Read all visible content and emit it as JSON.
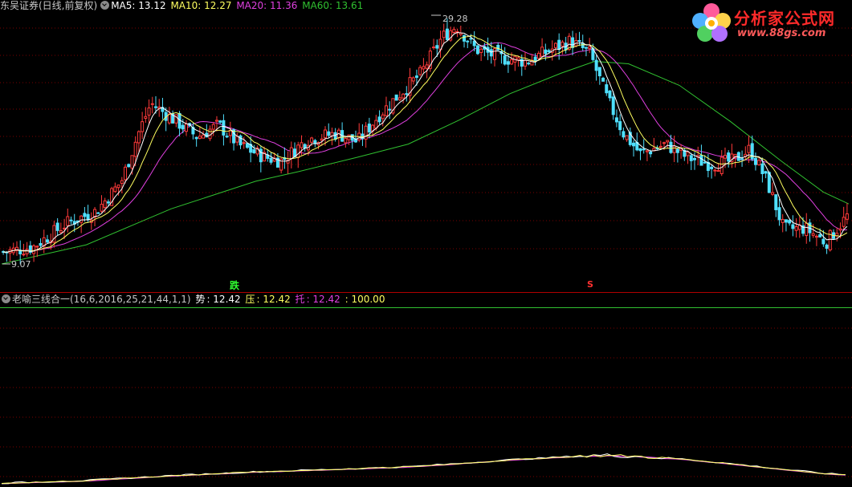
{
  "main_legend": {
    "stock_name": "东吴证券(日线,前复权)",
    "ma5": "MA5: 13.12",
    "ma10": "MA10: 12.27",
    "ma20": "MA20: 11.36",
    "ma60": "MA60: 13.61"
  },
  "indicator_legend": {
    "name": "老喻三线合一(16,6,2016,25,21,44,1,1)",
    "shi_label": "势",
    "shi_value": ": 12.42",
    "ya_label": "压",
    "ya_value": ": 12.42",
    "tuo_label": "托",
    "tuo_value": ": 12.42",
    "extra_value": ": 100.00"
  },
  "annotations": {
    "high_price": "29.28",
    "low_price": "9.07",
    "signal_die": "跌",
    "signal_s": "S"
  },
  "logo": {
    "text": "分析家公式网",
    "url": "www.88gs.com"
  },
  "colors": {
    "background": "#000000",
    "up": "#ff3a3a",
    "down": "#4fe0ff",
    "ma5": "#ffffff",
    "ma10": "#ffff60",
    "ma20": "#e040e0",
    "ma60": "#30c030",
    "grid": "#7a0000",
    "legend_text": "#c8c8c8"
  },
  "chart_data": {
    "type": "candlestick",
    "y_high": 29.28,
    "y_low": 9.07,
    "ma_latest": {
      "MA5": 13.12,
      "MA10": 12.27,
      "MA20": 11.36,
      "MA60": 13.61
    },
    "price_path": [
      {
        "x": 0.0,
        "price": 9.6
      },
      {
        "x": 0.035,
        "price": 10.0
      },
      {
        "x": 0.075,
        "price": 12.0
      },
      {
        "x": 0.11,
        "price": 13.0
      },
      {
        "x": 0.14,
        "price": 15.5
      },
      {
        "x": 0.16,
        "price": 19.5
      },
      {
        "x": 0.175,
        "price": 22.0
      },
      {
        "x": 0.205,
        "price": 20.5
      },
      {
        "x": 0.23,
        "price": 19.2
      },
      {
        "x": 0.255,
        "price": 20.2
      },
      {
        "x": 0.28,
        "price": 18.5
      },
      {
        "x": 0.31,
        "price": 17.5
      },
      {
        "x": 0.33,
        "price": 17.2
      },
      {
        "x": 0.36,
        "price": 19.0
      },
      {
        "x": 0.395,
        "price": 19.5
      },
      {
        "x": 0.42,
        "price": 18.8
      },
      {
        "x": 0.445,
        "price": 21.0
      },
      {
        "x": 0.47,
        "price": 22.8
      },
      {
        "x": 0.495,
        "price": 24.5
      },
      {
        "x": 0.52,
        "price": 27.5
      },
      {
        "x": 0.537,
        "price": 28.5
      },
      {
        "x": 0.56,
        "price": 26.5
      },
      {
        "x": 0.59,
        "price": 25.8
      },
      {
        "x": 0.62,
        "price": 25.5
      },
      {
        "x": 0.65,
        "price": 26.5
      },
      {
        "x": 0.672,
        "price": 27.2
      },
      {
        "x": 0.695,
        "price": 26.2
      },
      {
        "x": 0.715,
        "price": 22.5
      },
      {
        "x": 0.735,
        "price": 19.5
      },
      {
        "x": 0.755,
        "price": 17.8
      },
      {
        "x": 0.785,
        "price": 18.6
      },
      {
        "x": 0.81,
        "price": 17.5
      },
      {
        "x": 0.84,
        "price": 16.9
      },
      {
        "x": 0.865,
        "price": 17.2
      },
      {
        "x": 0.885,
        "price": 18.2
      },
      {
        "x": 0.905,
        "price": 15.5
      },
      {
        "x": 0.925,
        "price": 11.5
      },
      {
        "x": 0.95,
        "price": 11.6
      },
      {
        "x": 0.975,
        "price": 10.4
      },
      {
        "x": 1.0,
        "price": 12.6
      }
    ],
    "ma60_path": [
      {
        "x": 0.0,
        "price": 8.6
      },
      {
        "x": 0.1,
        "price": 10.2
      },
      {
        "x": 0.2,
        "price": 13.2
      },
      {
        "x": 0.3,
        "price": 15.5
      },
      {
        "x": 0.35,
        "price": 16.3
      },
      {
        "x": 0.42,
        "price": 17.5
      },
      {
        "x": 0.48,
        "price": 18.6
      },
      {
        "x": 0.54,
        "price": 20.6
      },
      {
        "x": 0.6,
        "price": 22.8
      },
      {
        "x": 0.66,
        "price": 24.5
      },
      {
        "x": 0.7,
        "price": 25.5
      },
      {
        "x": 0.74,
        "price": 25.3
      },
      {
        "x": 0.8,
        "price": 23.5
      },
      {
        "x": 0.86,
        "price": 20.5
      },
      {
        "x": 0.92,
        "price": 17.2
      },
      {
        "x": 0.97,
        "price": 14.6
      },
      {
        "x": 1.0,
        "price": 13.61
      }
    ]
  }
}
